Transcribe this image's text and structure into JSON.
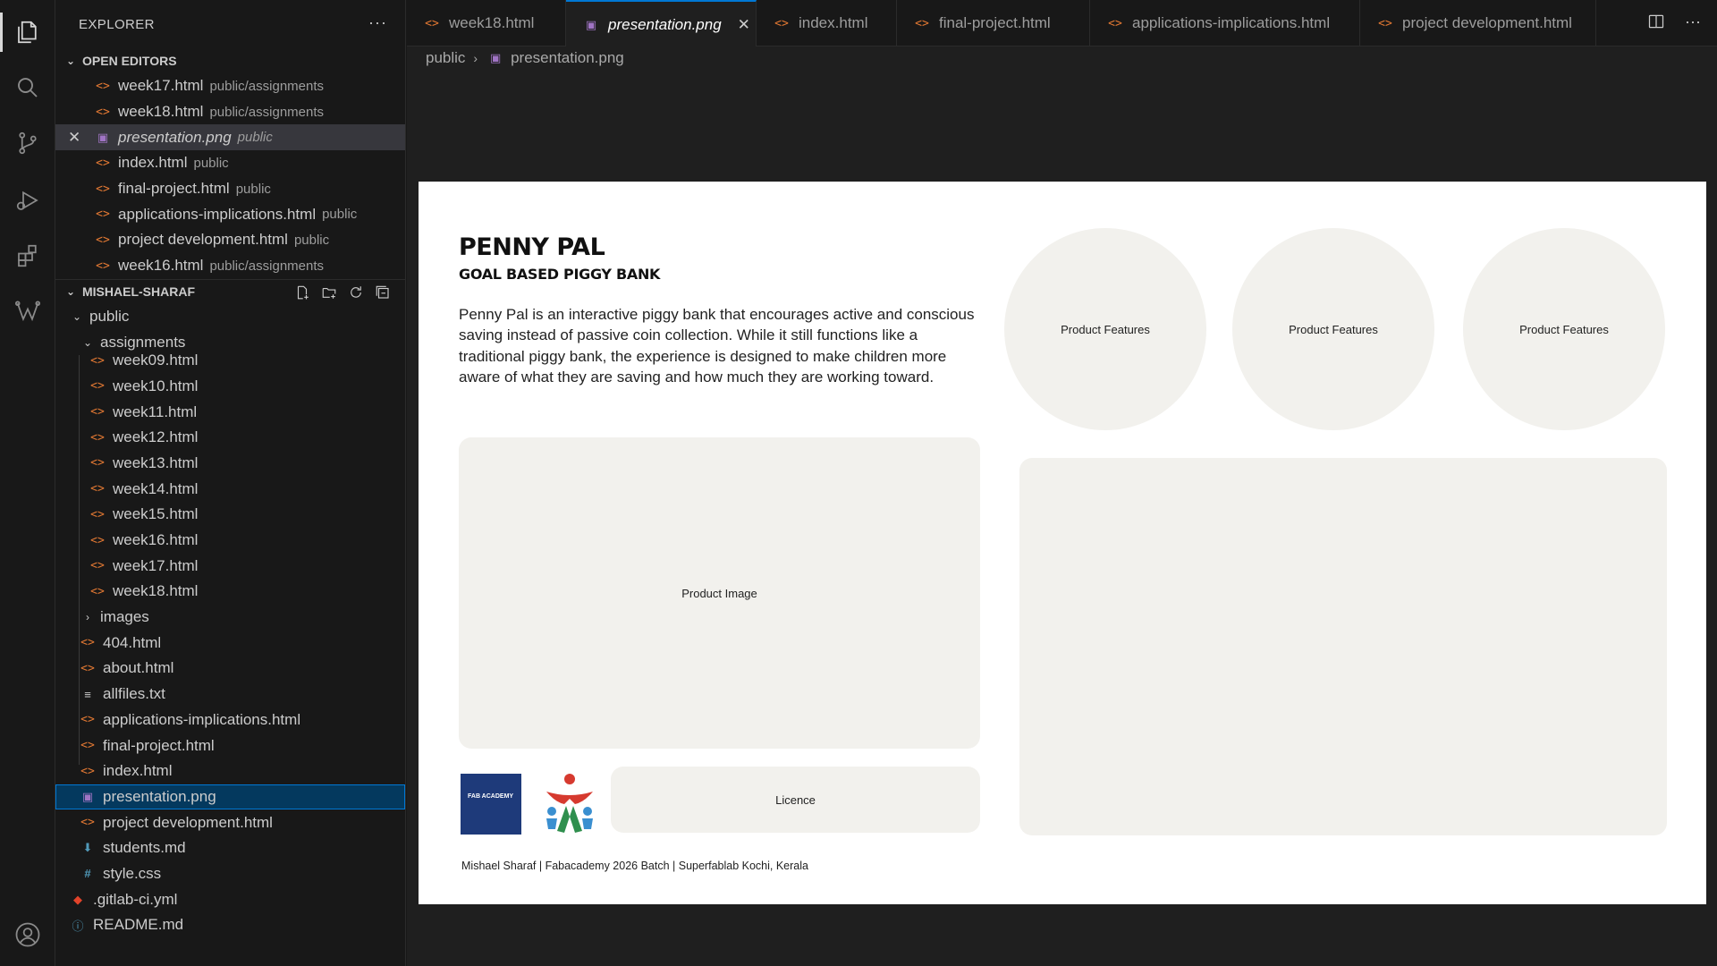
{
  "sidebar": {
    "title": "EXPLORER",
    "more": "···",
    "open_editors": {
      "header": "OPEN EDITORS",
      "items": [
        {
          "name": "week17.html",
          "desc": "public/assignments",
          "icon": "html-icon"
        },
        {
          "name": "week18.html",
          "desc": "public/assignments",
          "icon": "html-icon"
        },
        {
          "name": "presentation.png",
          "desc": "public",
          "icon": "image-icon",
          "active": true
        },
        {
          "name": "index.html",
          "desc": "public",
          "icon": "html-icon"
        },
        {
          "name": "final-project.html",
          "desc": "public",
          "icon": "html-icon"
        },
        {
          "name": "applications-implications.html",
          "desc": "public",
          "icon": "html-icon"
        },
        {
          "name": "project development.html",
          "desc": "public",
          "icon": "html-icon"
        },
        {
          "name": "week16.html",
          "desc": "public/assignments",
          "icon": "html-icon"
        }
      ]
    },
    "workspace": {
      "header": "MISHAEL-SHARAF",
      "public_folder": "public",
      "assignments_folder": "assignments",
      "assignment_files": [
        "week09.html",
        "week10.html",
        "week11.html",
        "week12.html",
        "week13.html",
        "week14.html",
        "week15.html",
        "week16.html",
        "week17.html",
        "week18.html"
      ],
      "images_folder": "images",
      "public_files": [
        {
          "name": "404.html",
          "icon": "html-icon"
        },
        {
          "name": "about.html",
          "icon": "html-icon"
        },
        {
          "name": "allfiles.txt",
          "icon": "text-icon"
        },
        {
          "name": "applications-implications.html",
          "icon": "html-icon"
        },
        {
          "name": "final-project.html",
          "icon": "html-icon"
        },
        {
          "name": "index.html",
          "icon": "html-icon"
        },
        {
          "name": "presentation.png",
          "icon": "image-icon",
          "selected": true
        },
        {
          "name": "project development.html",
          "icon": "html-icon"
        },
        {
          "name": "students.md",
          "icon": "markdown-icon"
        },
        {
          "name": "style.css",
          "icon": "css-icon"
        }
      ],
      "root_files": [
        {
          "name": ".gitlab-ci.yml",
          "icon": "gitlab-icon"
        },
        {
          "name": "README.md",
          "icon": "info-icon"
        }
      ]
    }
  },
  "tabs": [
    {
      "label": "week18.html",
      "icon": "html-icon"
    },
    {
      "label": "presentation.png",
      "icon": "image-icon",
      "active": true
    },
    {
      "label": "index.html",
      "icon": "html-icon"
    },
    {
      "label": "final-project.html",
      "icon": "html-icon"
    },
    {
      "label": "applications-implications.html",
      "icon": "html-icon"
    },
    {
      "label": "project development.html",
      "icon": "html-icon"
    }
  ],
  "breadcrumb": {
    "folder": "public",
    "file": "presentation.png"
  },
  "slide": {
    "title": "PENNY PAL",
    "subtitle": "GOAL BASED PIGGY BANK",
    "paragraph": "Penny Pal is an interactive piggy bank that encourages active and conscious saving instead of passive coin collection. While it still functions like a traditional piggy bank, the experience is designed to make children more aware of what they are saving and how much they are working toward.",
    "features": [
      "Product Features",
      "Product Features",
      "Product Features"
    ],
    "product_image": "Product Image",
    "licence": "Licence",
    "logo_text": "FAB ACADEMY",
    "footer": "Mishael Sharaf | Fabacademy 2026 Batch | Superfablab Kochi, Kerala"
  },
  "colors": {
    "accent": "#0078d4",
    "html_icon": "#e37933",
    "image_icon": "#a074c4",
    "slide_panel": "#f2f1ed"
  }
}
